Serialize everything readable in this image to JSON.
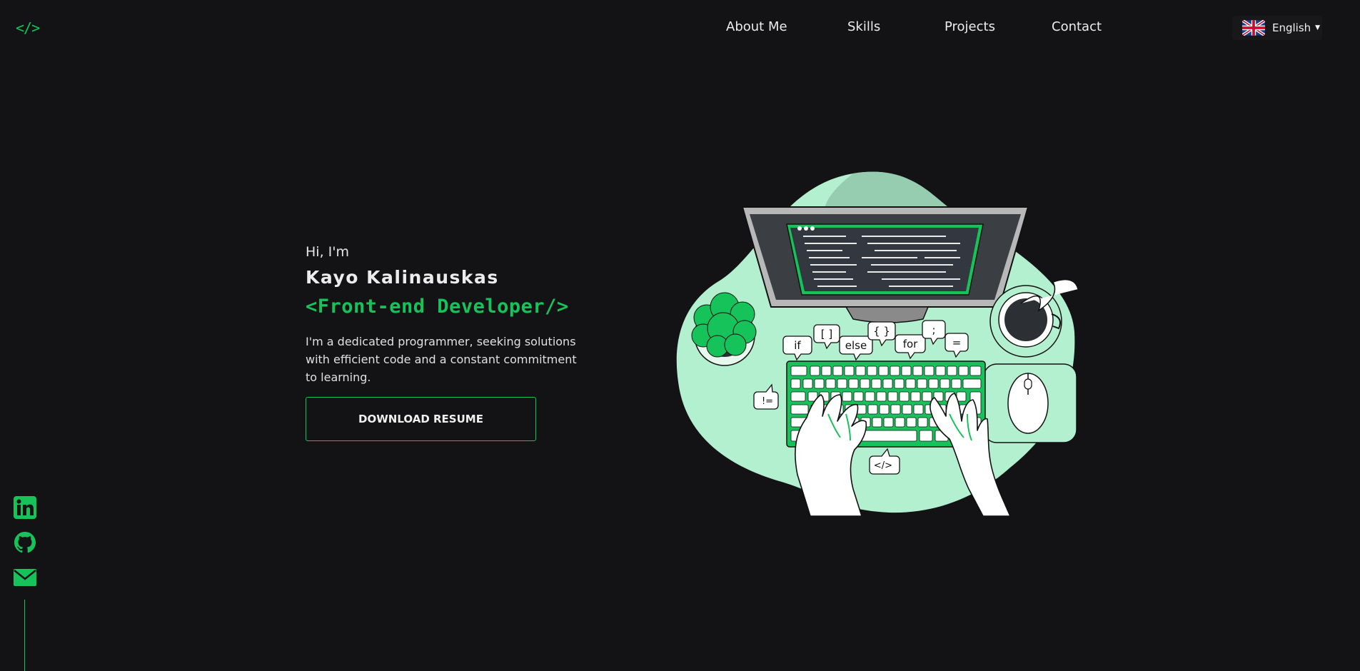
{
  "header": {
    "logo": "</>",
    "nav": [
      "About Me",
      "Skills",
      "Projects",
      "Contact"
    ],
    "language": {
      "label": "English",
      "flag": "uk-flag-icon"
    }
  },
  "hero": {
    "greeting": "Hi, I'm",
    "name": "Kayo Kalinauskas",
    "role": "<Front-end Developer/>",
    "description": "I'm a dedicated programmer, seeking solutions with efficient code and a constant commitment to learning.",
    "button": "DOWNLOAD RESUME"
  },
  "illustration": {
    "bubbles": [
      "if",
      "[ ]",
      "else",
      "{ }",
      "for",
      ";",
      "=",
      "!=",
      "</>"
    ]
  },
  "social": {
    "icons": [
      "linkedin-icon",
      "github-icon",
      "email-icon"
    ]
  },
  "colors": {
    "accent": "#16c25a",
    "background": "#131315",
    "mint": "#b3f0cf",
    "text": "#e6e6e6"
  }
}
